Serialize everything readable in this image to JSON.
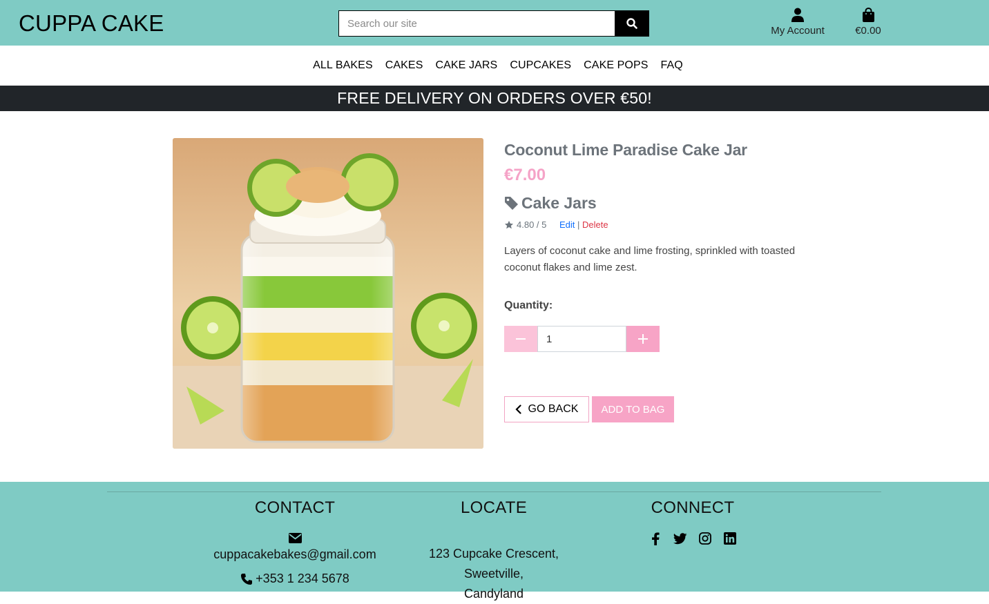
{
  "header": {
    "logo": "CUPPA CAKE",
    "search_placeholder": "Search our site",
    "account_label": "My Account",
    "bag_total": "€0.00"
  },
  "nav": {
    "items": [
      "ALL BAKES",
      "CAKES",
      "CAKE JARS",
      "CUPCAKES",
      "CAKE POPS",
      "FAQ"
    ]
  },
  "banner": {
    "text": "FREE DELIVERY ON ORDERS OVER €50!"
  },
  "product": {
    "name": "Coconut Lime Paradise Cake Jar",
    "price": "€7.00",
    "category": "Cake Jars",
    "rating": "4.80 / 5",
    "edit_label": "Edit",
    "separator": "|",
    "delete_label": "Delete",
    "description": "Layers of coconut cake and lime frosting, sprinkled with toasted coconut flakes and lime zest.",
    "quantity_label": "Quantity:",
    "quantity_value": "1",
    "go_back_label": "GO BACK",
    "add_to_bag_label": "ADD TO BAG"
  },
  "footer": {
    "contact": {
      "heading": "CONTACT",
      "email": "cuppacakebakes@gmail.com",
      "phone": "+353 1 234 5678"
    },
    "locate": {
      "heading": "LOCATE",
      "line1": "123 Cupcake Crescent,",
      "line2": "Sweetville,",
      "line3": "Candyland"
    },
    "connect": {
      "heading": "CONNECT",
      "icons": [
        "facebook-icon",
        "twitter-icon",
        "instagram-icon",
        "linkedin-icon"
      ]
    }
  },
  "colors": {
    "header_bg": "#7fcbc4",
    "banner_bg": "#212529",
    "accent_pink": "#f7a4c6",
    "text_grey": "#6c737a"
  }
}
